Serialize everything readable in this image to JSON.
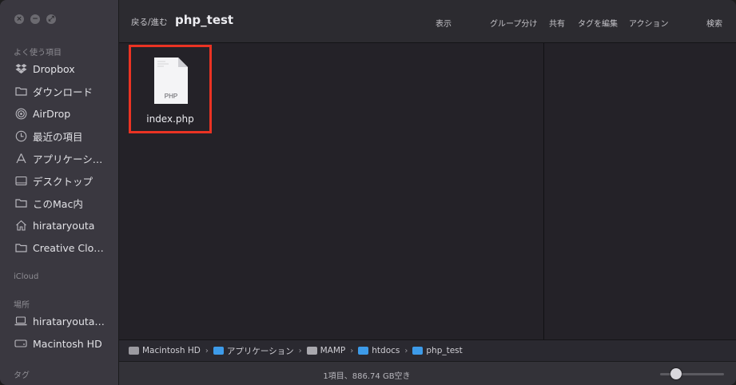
{
  "sidebar": {
    "favorites_label": "よく使う項目",
    "items": [
      {
        "label": "Dropbox",
        "icon": "dropbox-icon"
      },
      {
        "label": "ダウンロード",
        "icon": "folder-icon"
      },
      {
        "label": "AirDrop",
        "icon": "airdrop-icon"
      },
      {
        "label": "最近の項目",
        "icon": "clock-icon"
      },
      {
        "label": "アプリケーシ…",
        "icon": "applications-icon"
      },
      {
        "label": "デスクトップ",
        "icon": "desktop-icon"
      },
      {
        "label": "このMac内",
        "icon": "folder-icon"
      },
      {
        "label": "hirataryouta",
        "icon": "home-icon"
      },
      {
        "label": "Creative Clo…",
        "icon": "folder-icon"
      }
    ],
    "icloud_label": "iCloud",
    "locations_label": "場所",
    "locations": [
      {
        "label": "hirataryouta…",
        "icon": "laptop-icon"
      },
      {
        "label": "Macintosh HD",
        "icon": "hard-drive-icon"
      }
    ],
    "tags_label": "タグ"
  },
  "toolbar": {
    "back_forward": "戻る/進む",
    "title": "php_test",
    "view": "表示",
    "group": "グループ分け",
    "share": "共有",
    "edit_tags": "タグを編集",
    "action": "アクション",
    "search": "検索"
  },
  "content": {
    "files": [
      {
        "name": "index.php",
        "type_label": "PHP",
        "selected": true
      }
    ]
  },
  "pathbar": {
    "items": [
      {
        "label": "Macintosh HD",
        "icon": "hard-drive-icon"
      },
      {
        "label": "アプリケーション",
        "icon": "folder-icon"
      },
      {
        "label": "MAMP",
        "icon": "folder-icon"
      },
      {
        "label": "htdocs",
        "icon": "folder-icon"
      },
      {
        "label": "php_test",
        "icon": "folder-icon"
      }
    ]
  },
  "statusbar": {
    "text": "1項目、886.74 GB空き",
    "icon_size_level": 0.25
  },
  "colors": {
    "highlight": "#ea3323",
    "folder_blue": "#3d9be9"
  }
}
